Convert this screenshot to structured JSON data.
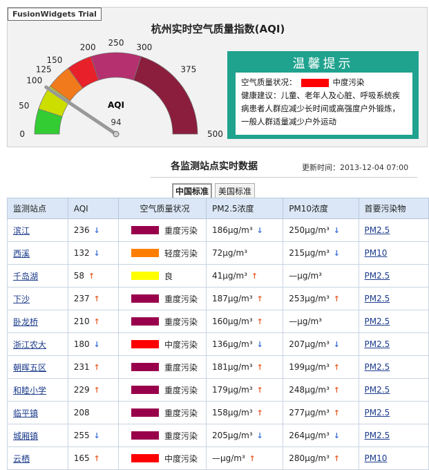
{
  "trial_label": "FusionWidgets Trial",
  "gauge": {
    "title": "杭州实时空气质量指数(AQI)",
    "value": 94,
    "value_label": "94",
    "aqi_label": "AQI",
    "min": 0,
    "max": 500,
    "tick_labels": [
      "0",
      "50",
      "100",
      "125",
      "150",
      "200",
      "250",
      "300",
      "375",
      "500"
    ],
    "tick_values": [
      0,
      50,
      100,
      125,
      150,
      200,
      250,
      300,
      375,
      500
    ],
    "bands": [
      {
        "from": 0,
        "to": 50,
        "color": "#33cc33"
      },
      {
        "from": 50,
        "to": 100,
        "color": "#ccdd00"
      },
      {
        "from": 100,
        "to": 150,
        "color": "#f07a1c"
      },
      {
        "from": 150,
        "to": 200,
        "color": "#e8202a"
      },
      {
        "from": 200,
        "to": 300,
        "color": "#b5306e"
      },
      {
        "from": 300,
        "to": 500,
        "color": "#8a1e3c"
      }
    ]
  },
  "tip": {
    "title": "温馨提示",
    "status_label": "空气质量状况：",
    "status_color": "#ff0000",
    "status_value": "中度污染",
    "advice": "健康建议：儿童、老年人及心脏、呼吸系统疾病患者人群应减少长时间或高强度户外锻炼，一般人群适量减少户外运动"
  },
  "section_title": "各监测站点实时数据",
  "update_time": "更新时间：2013-12-04 07:00",
  "tabs": [
    {
      "label": "中国标准",
      "active": true
    },
    {
      "label": "美国标准",
      "active": false
    }
  ],
  "table": {
    "headers": [
      "监测站点",
      "AQI",
      "空气质量状况",
      "PM2.5浓度",
      "PM10浓度",
      "首要污染物"
    ],
    "rows": [
      {
        "station": "滨江",
        "aqi": "236",
        "aqi_trend": "down",
        "status": "重度污染",
        "status_color": "#99004c",
        "pm25": "186μg/m³",
        "pm25_trend": "down",
        "pm10": "250μg/m³",
        "pm10_trend": "down",
        "primary": "PM2.5"
      },
      {
        "station": "西溪",
        "aqi": "132",
        "aqi_trend": "down",
        "status": "轻度污染",
        "status_color": "#ff7e00",
        "pm25": "72μg/m³",
        "pm25_trend": "",
        "pm10": "215μg/m³",
        "pm10_trend": "down",
        "primary": "PM10"
      },
      {
        "station": "千岛湖",
        "aqi": "58",
        "aqi_trend": "up",
        "status": "良",
        "status_color": "#ffff00",
        "pm25": "41μg/m³",
        "pm25_trend": "up",
        "pm10": "—μg/m³",
        "pm10_trend": "",
        "primary": "PM2.5"
      },
      {
        "station": "下沙",
        "aqi": "237",
        "aqi_trend": "up",
        "status": "重度污染",
        "status_color": "#99004c",
        "pm25": "187μg/m³",
        "pm25_trend": "up",
        "pm10": "253μg/m³",
        "pm10_trend": "up",
        "primary": "PM2.5"
      },
      {
        "station": "卧龙桥",
        "aqi": "210",
        "aqi_trend": "up",
        "status": "重度污染",
        "status_color": "#99004c",
        "pm25": "160μg/m³",
        "pm25_trend": "up",
        "pm10": "—μg/m³",
        "pm10_trend": "",
        "primary": "PM2.5"
      },
      {
        "station": "浙江农大",
        "aqi": "180",
        "aqi_trend": "down",
        "status": "中度污染",
        "status_color": "#ff0000",
        "pm25": "136μg/m³",
        "pm25_trend": "down",
        "pm10": "207μg/m³",
        "pm10_trend": "down",
        "primary": "PM2.5"
      },
      {
        "station": "朝晖五区",
        "aqi": "231",
        "aqi_trend": "up",
        "status": "重度污染",
        "status_color": "#99004c",
        "pm25": "181μg/m³",
        "pm25_trend": "up",
        "pm10": "199μg/m³",
        "pm10_trend": "up",
        "primary": "PM2.5"
      },
      {
        "station": "和睦小学",
        "aqi": "229",
        "aqi_trend": "up",
        "status": "重度污染",
        "status_color": "#99004c",
        "pm25": "179μg/m³",
        "pm25_trend": "up",
        "pm10": "248μg/m³",
        "pm10_trend": "up",
        "primary": "PM2.5"
      },
      {
        "station": "临平镇",
        "aqi": "208",
        "aqi_trend": "",
        "status": "重度污染",
        "status_color": "#99004c",
        "pm25": "158μg/m³",
        "pm25_trend": "up",
        "pm10": "277μg/m³",
        "pm10_trend": "up",
        "primary": "PM2.5"
      },
      {
        "station": "城厢镇",
        "aqi": "255",
        "aqi_trend": "down",
        "status": "重度污染",
        "status_color": "#99004c",
        "pm25": "205μg/m³",
        "pm25_trend": "down",
        "pm10": "264μg/m³",
        "pm10_trend": "down",
        "primary": "PM2.5"
      },
      {
        "station": "云栖",
        "aqi": "165",
        "aqi_trend": "up",
        "status": "中度污染",
        "status_color": "#ff0000",
        "pm25": "—μg/m³",
        "pm25_trend": "up",
        "pm10": "280μg/m³",
        "pm10_trend": "up",
        "primary": "PM10"
      }
    ]
  }
}
